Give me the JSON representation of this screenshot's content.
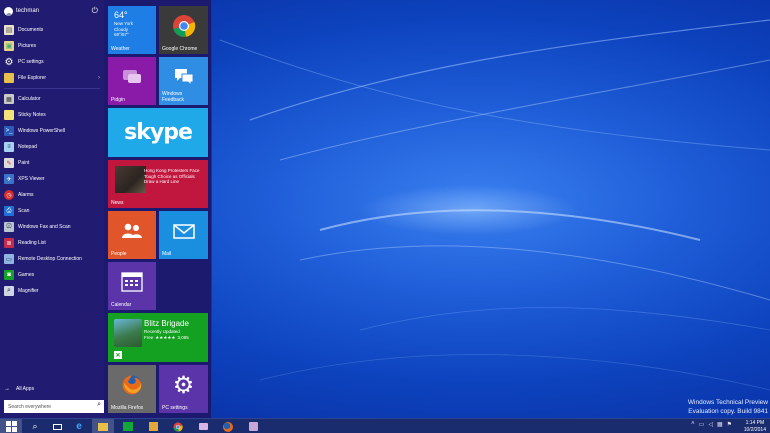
{
  "user": {
    "name": "techman"
  },
  "menu": {
    "pinned": [
      {
        "label": "Documents",
        "icon": "documents-icon"
      },
      {
        "label": "Pictures",
        "icon": "pictures-icon"
      },
      {
        "label": "PC settings",
        "icon": "gear-icon"
      },
      {
        "label": "File Explorer",
        "icon": "folder-icon"
      }
    ],
    "recent": [
      {
        "label": "Calculator"
      },
      {
        "label": "Sticky Notes"
      },
      {
        "label": "Windows PowerShell"
      },
      {
        "label": "Notepad"
      },
      {
        "label": "Paint"
      },
      {
        "label": "XPS Viewer"
      },
      {
        "label": "Alarms"
      },
      {
        "label": "Scan"
      },
      {
        "label": "Windows Fax and Scan"
      },
      {
        "label": "Reading List"
      },
      {
        "label": "Remote Desktop Connection"
      },
      {
        "label": "Games"
      },
      {
        "label": "Magnifier"
      }
    ],
    "all_apps": "All Apps",
    "search_placeholder": "Search everywhere"
  },
  "tiles": {
    "weather": {
      "label": "Weather",
      "temp": "64°",
      "city": "New York",
      "condition": "Cloudy",
      "range": "69°/57°"
    },
    "chrome": {
      "label": "Google Chrome"
    },
    "pidgin": {
      "label": "Pidgin"
    },
    "feedback": {
      "label_line1": "Windows",
      "label_line2": "Feedback"
    },
    "skype": {
      "label": "skype"
    },
    "news": {
      "label": "News",
      "headline": "Hong Kong Protesters Face Tough Choice as Officials Draw a Hard Line"
    },
    "people": {
      "label": "People"
    },
    "mail": {
      "label": "Mail"
    },
    "calendar": {
      "label": "Calendar"
    },
    "game": {
      "title": "Blitz Brigade",
      "subtitle": "Recently Updated",
      "price": "Free",
      "stars": "★★★★★",
      "rating_count": "3,095"
    },
    "firefox": {
      "label": "Mozilla Firefox"
    },
    "pcsettings": {
      "label": "PC settings"
    }
  },
  "watermark": {
    "line1": "Windows Technical Preview",
    "line2": "Evaluation copy. Build 9841"
  },
  "clock": {
    "time": "1:14 PM",
    "date": "10/2/2014"
  },
  "colors": {
    "menu_bg": "#1c1a6e",
    "weather": "#1e7ee6",
    "pidgin": "#8a1aa8",
    "feedback": "#2f8de4",
    "skype": "#1fa9e9",
    "news": "#c1173f",
    "people": "#e0552a",
    "mail": "#1a8fe0",
    "calendar": "#5a34a8",
    "game": "#14a020",
    "firefox": "#6a6a6a",
    "pcsettings": "#5a34a8"
  }
}
